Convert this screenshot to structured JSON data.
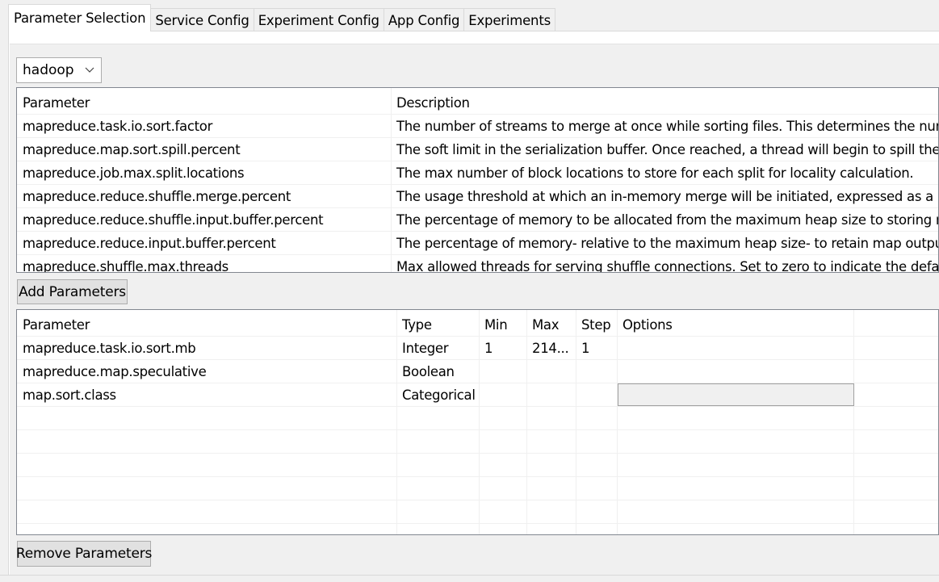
{
  "tabs": [
    {
      "label": "Parameter Selection",
      "active": true
    },
    {
      "label": "Service Config",
      "active": false
    },
    {
      "label": "Experiment Config",
      "active": false
    },
    {
      "label": "App Config",
      "active": false
    },
    {
      "label": "Experiments",
      "active": false
    }
  ],
  "service_select": {
    "selected": "hadoop"
  },
  "available_params": {
    "columns": [
      "Parameter",
      "Description"
    ],
    "rows": [
      [
        "mapreduce.task.io.sort.factor",
        "The number of streams to merge at once while sorting files. This determines the num"
      ],
      [
        "mapreduce.map.sort.spill.percent",
        "The soft limit in the serialization buffer. Once reached, a thread will begin to spill the c"
      ],
      [
        "mapreduce.job.max.split.locations",
        "The max number of block locations to store for each split for locality calculation."
      ],
      [
        "mapreduce.reduce.shuffle.merge.percent",
        "The usage threshold at which an in-memory merge will be initiated, expressed as a pe"
      ],
      [
        "mapreduce.reduce.shuffle.input.buffer.percent",
        "The percentage of memory to be allocated from the maximum heap size to storing m"
      ],
      [
        "mapreduce.reduce.input.buffer.percent",
        "The percentage of memory- relative to the maximum heap size- to retain map output"
      ],
      [
        "mapreduce.shuffle.max.threads",
        "Max allowed threads for serving shuffle connections. Set to zero to indicate the defau"
      ]
    ]
  },
  "add_button": {
    "label": "Add Parameters"
  },
  "selected_params": {
    "columns": [
      "Parameter",
      "Type",
      "Min",
      "Max",
      "Step",
      "Options"
    ],
    "rows": [
      [
        "mapreduce.task.io.sort.mb",
        "Integer",
        "1",
        "214...",
        "1",
        ""
      ],
      [
        "mapreduce.map.speculative",
        "Boolean",
        "",
        "",
        "",
        ""
      ],
      [
        "map.sort.class",
        "Categorical",
        "",
        "",
        "",
        ""
      ]
    ]
  },
  "remove_button": {
    "label": "Remove Parameters"
  }
}
